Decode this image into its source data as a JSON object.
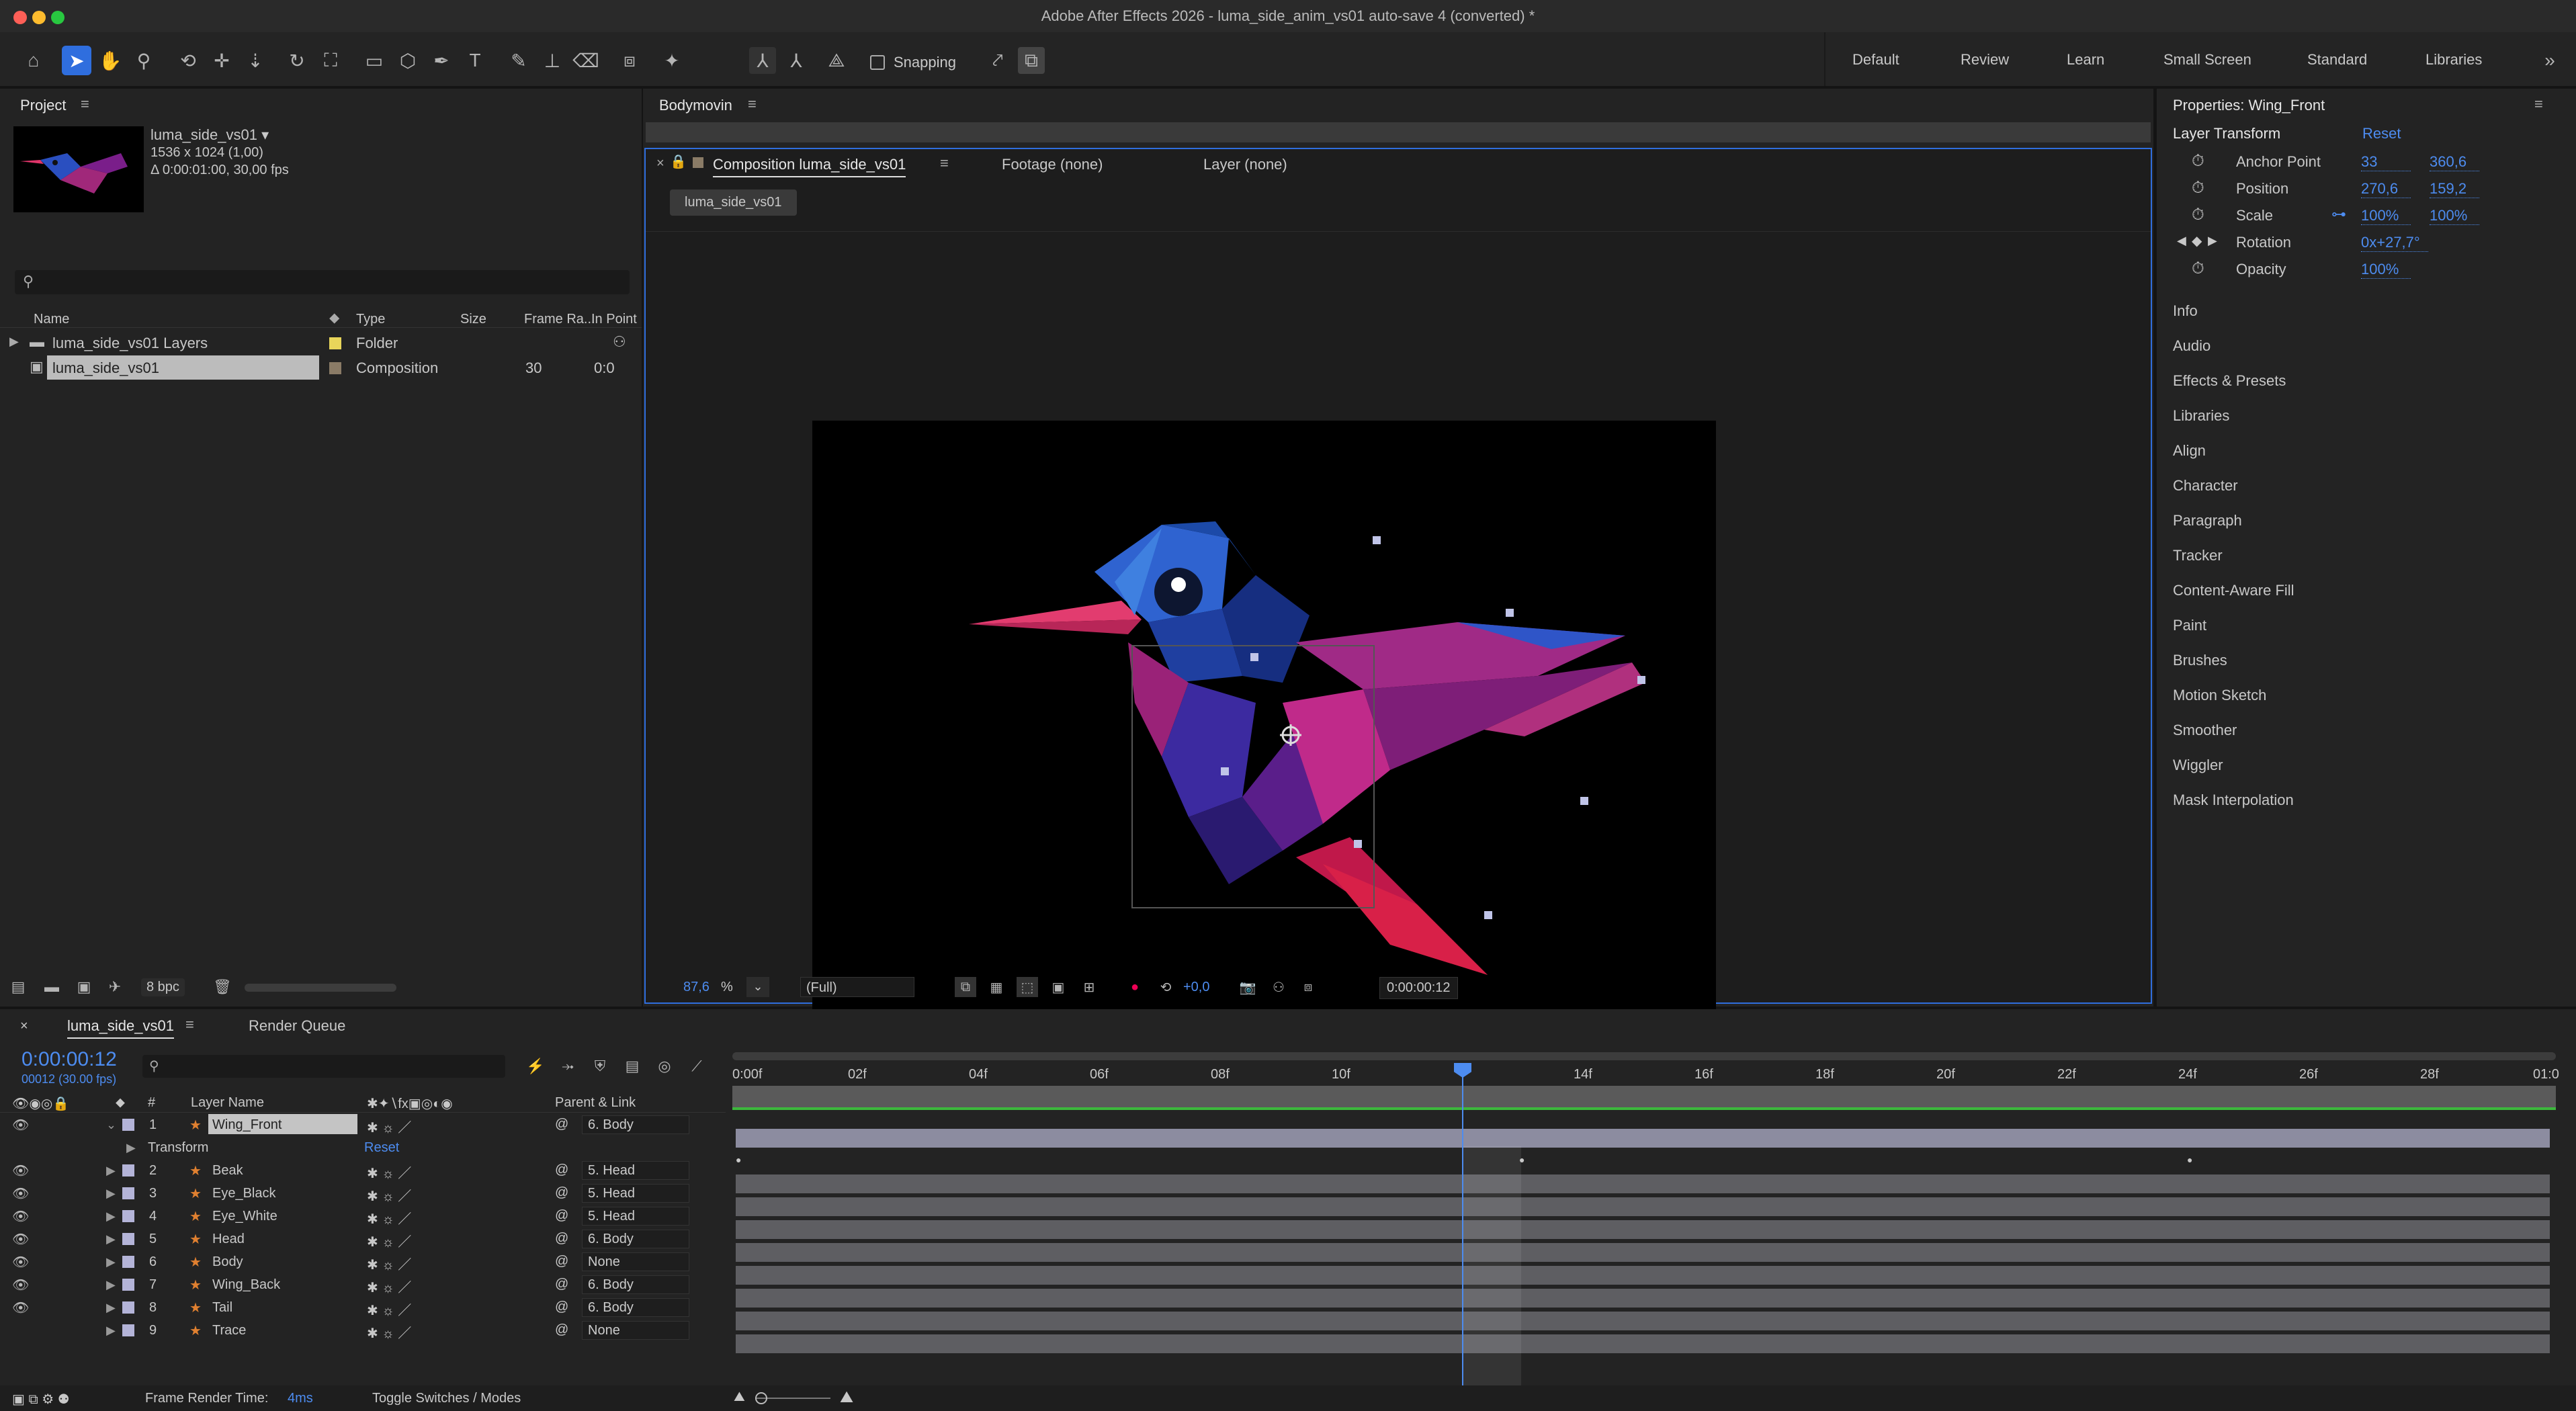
{
  "window": {
    "title": "Adobe After Effects 2026 - luma_side_anim_vs01 auto-save 4 (converted) *"
  },
  "toolbar": {
    "snapping_label": "Snapping"
  },
  "workspaces": [
    "Default",
    "Review",
    "Learn",
    "Small Screen",
    "Standard",
    "Libraries"
  ],
  "project": {
    "tab": "Project",
    "comp_name": "luma_side_vs01 ▾",
    "comp_size": "1536 x 1024 (1,00)",
    "comp_duration": "Δ 0:00:01:00, 30,00 fps",
    "search_placeholder": "",
    "columns": [
      "Name",
      "Type",
      "Size",
      "Frame Ra...",
      "In Point"
    ],
    "items": [
      {
        "name": "luma_side_vs01 Layers",
        "type": "Folder",
        "size": "",
        "fps": "",
        "in": ""
      },
      {
        "name": "luma_side_vs01",
        "type": "Composition",
        "size": "",
        "fps": "30",
        "in": "0:0"
      }
    ],
    "bpc": "8 bpc"
  },
  "bodymovin": {
    "tab": "Bodymovin"
  },
  "viewer": {
    "tabs": [
      "Composition luma_side_vs01",
      "Footage (none)",
      "Layer (none)"
    ],
    "comp_chip": "luma_side_vs01",
    "zoom": "87,6",
    "zoom_unit": "%",
    "resolution": "(Full)",
    "exposure": "+0,0",
    "timecode": "0:00:00:12"
  },
  "properties": {
    "title": "Properties: Wing_Front",
    "section": "Layer Transform",
    "reset": "Reset",
    "rows": [
      {
        "label": "Anchor Point",
        "v1": "33",
        "v2": "360,6"
      },
      {
        "label": "Position",
        "v1": "270,6",
        "v2": "159,2"
      },
      {
        "label": "Scale",
        "v1": "100%",
        "v2": "100%"
      },
      {
        "label": "Rotation",
        "v1": "0x+27,7°",
        "v2": ""
      },
      {
        "label": "Opacity",
        "v1": "100%",
        "v2": ""
      }
    ],
    "panels": [
      "Info",
      "Audio",
      "Effects & Presets",
      "Libraries",
      "Align",
      "Character",
      "Paragraph",
      "Tracker",
      "Content-Aware Fill",
      "Paint",
      "Brushes",
      "Motion Sketch",
      "Smoother",
      "Wiggler",
      "Mask Interpolation"
    ]
  },
  "timeline": {
    "tab": "luma_side_vs01",
    "render_queue": "Render Queue",
    "timecode": "0:00:00:12",
    "frame_info": "00012 (30.00 fps)",
    "col_num": "#",
    "col_layer": "Layer Name",
    "col_parent": "Parent & Link",
    "ruler": [
      "0:00f",
      "02f",
      "04f",
      "06f",
      "08f",
      "10f",
      "14f",
      "16f",
      "18f",
      "20f",
      "22f",
      "24f",
      "26f",
      "28f",
      "01:0"
    ],
    "transform_label": "Transform",
    "transform_reset": "Reset",
    "layers": [
      {
        "num": "1",
        "name": "Wing_Front",
        "parent": "6. Body"
      },
      {
        "num": "2",
        "name": "Beak",
        "parent": "5. Head"
      },
      {
        "num": "3",
        "name": "Eye_Black",
        "parent": "5. Head"
      },
      {
        "num": "4",
        "name": "Eye_White",
        "parent": "5. Head"
      },
      {
        "num": "5",
        "name": "Head",
        "parent": "6. Body"
      },
      {
        "num": "6",
        "name": "Body",
        "parent": "None"
      },
      {
        "num": "7",
        "name": "Wing_Back",
        "parent": "6. Body"
      },
      {
        "num": "8",
        "name": "Tail",
        "parent": "6. Body"
      },
      {
        "num": "9",
        "name": "Trace",
        "parent": "None"
      }
    ],
    "render_time_label": "Frame Render Time:",
    "render_time": "4ms",
    "toggle_label": "Toggle Switches / Modes"
  },
  "colors": {
    "accent": "#4d8cf0",
    "bg": "#141414",
    "panel": "#232323"
  }
}
